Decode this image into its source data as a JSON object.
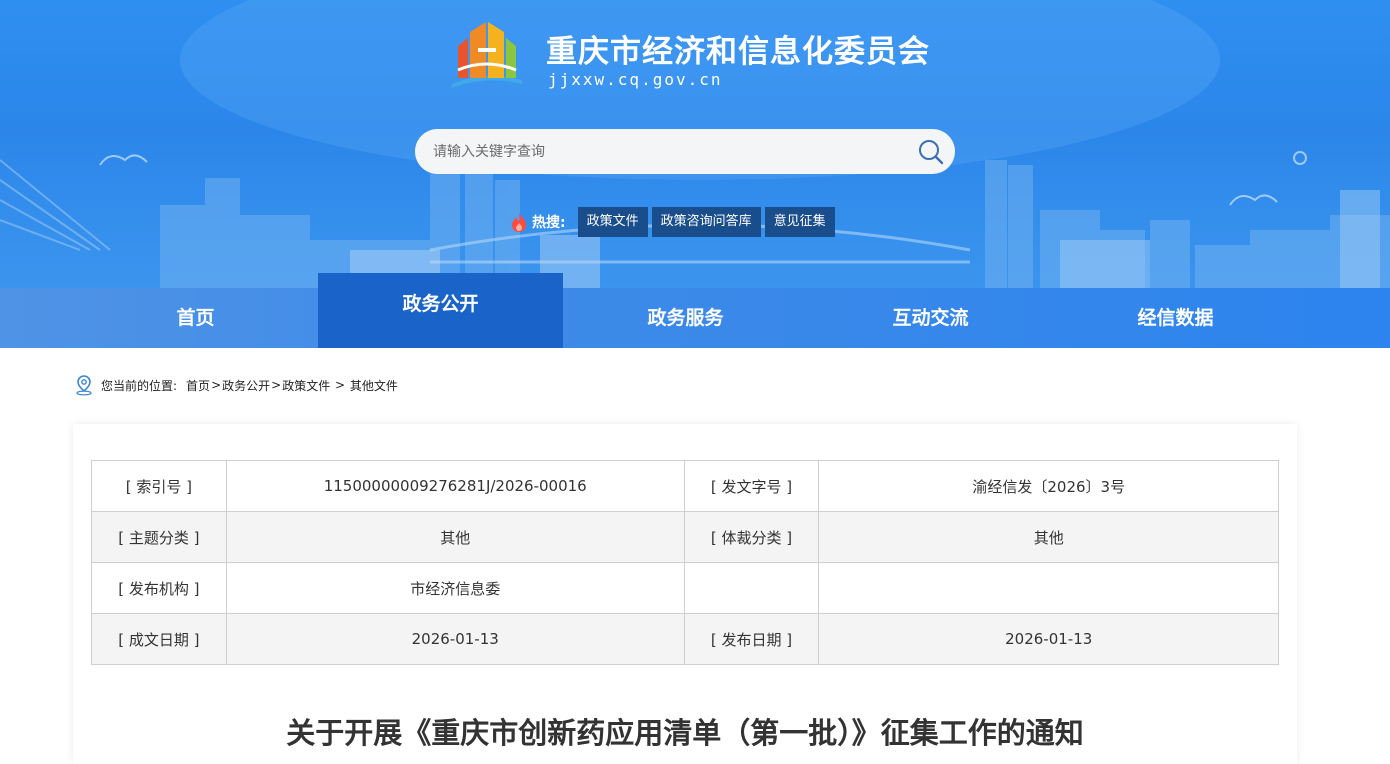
{
  "header": {
    "site_title": "重庆市经济和信息化委员会",
    "site_domain": "jjxxw.cq.gov.cn"
  },
  "search": {
    "placeholder": "请输入关键字查询"
  },
  "hot": {
    "label": "热搜:",
    "tags": [
      "政策文件",
      "政策咨询问答库",
      "意见征集"
    ]
  },
  "nav": {
    "items": [
      "首页",
      "政务公开",
      "政务服务",
      "互动交流",
      "经信数据"
    ],
    "active": "政务公开"
  },
  "breadcrumb": {
    "prefix": "您当前的位置:",
    "items": [
      "首页",
      "政务公开",
      "政策文件",
      "其他文件"
    ]
  },
  "meta_table": {
    "rows": [
      [
        "[ 索引号 ]",
        "11500000009276281J/2026-00016",
        "[ 发文字号 ]",
        "渝经信发〔2026〕3号"
      ],
      [
        "[ 主题分类 ]",
        "其他",
        "[ 体裁分类 ]",
        "其他"
      ],
      [
        "[ 发布机构 ]",
        "市经济信息委",
        "",
        ""
      ],
      [
        "[ 成文日期 ]",
        "2026-01-13",
        "[ 发布日期 ]",
        "2026-01-13"
      ]
    ]
  },
  "document": {
    "title": "关于开展《重庆市创新药应用清单（第一批）》征集工作的通知"
  },
  "colors": {
    "banner": "#2f8ff0",
    "nav": "#3d8ae8",
    "nav_active": "#1a63c8",
    "hot_tag": "#1a4d8c"
  }
}
